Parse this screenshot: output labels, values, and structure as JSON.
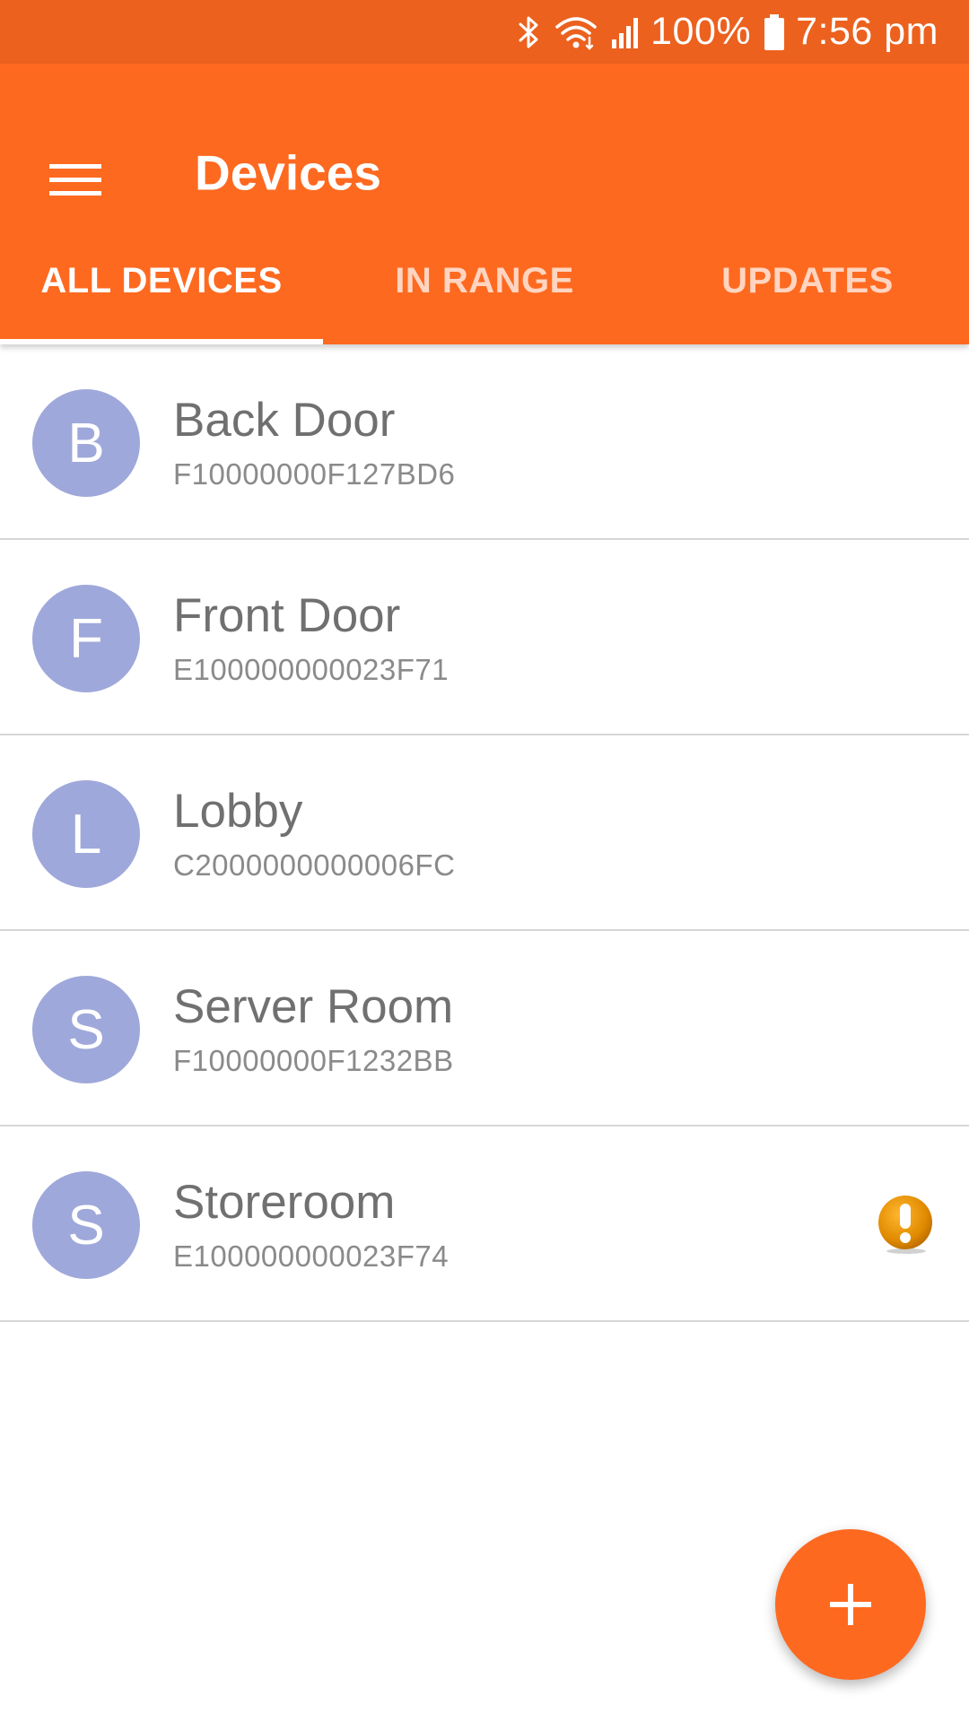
{
  "status_bar": {
    "icons": [
      "bluetooth-icon",
      "wifi-icon",
      "cell-signal-icon",
      "battery-icon"
    ],
    "battery": "100%",
    "time": "7:56 pm"
  },
  "app_bar": {
    "title": "Devices",
    "menu_icon": "hamburger-menu-icon"
  },
  "tabs": [
    {
      "label": "ALL DEVICES",
      "active": true
    },
    {
      "label": "IN RANGE",
      "active": false
    },
    {
      "label": "UPDATES",
      "active": false
    }
  ],
  "devices": [
    {
      "initial": "B",
      "name": "Back Door",
      "id": "F10000000F127BD6",
      "alert": false
    },
    {
      "initial": "F",
      "name": "Front Door",
      "id": "E100000000023F71",
      "alert": false
    },
    {
      "initial": "L",
      "name": "Lobby",
      "id": "C2000000000006FC",
      "alert": false
    },
    {
      "initial": "S",
      "name": "Server Room",
      "id": "F10000000F1232BB",
      "alert": false
    },
    {
      "initial": "S",
      "name": "Storeroom",
      "id": "E100000000023F74",
      "alert": true
    }
  ],
  "fab": {
    "icon": "plus-icon"
  },
  "colors": {
    "status_bar": "#ec611e",
    "app_bar": "#fe6920",
    "avatar": "#9fa8da",
    "alert": "#e08a00"
  }
}
